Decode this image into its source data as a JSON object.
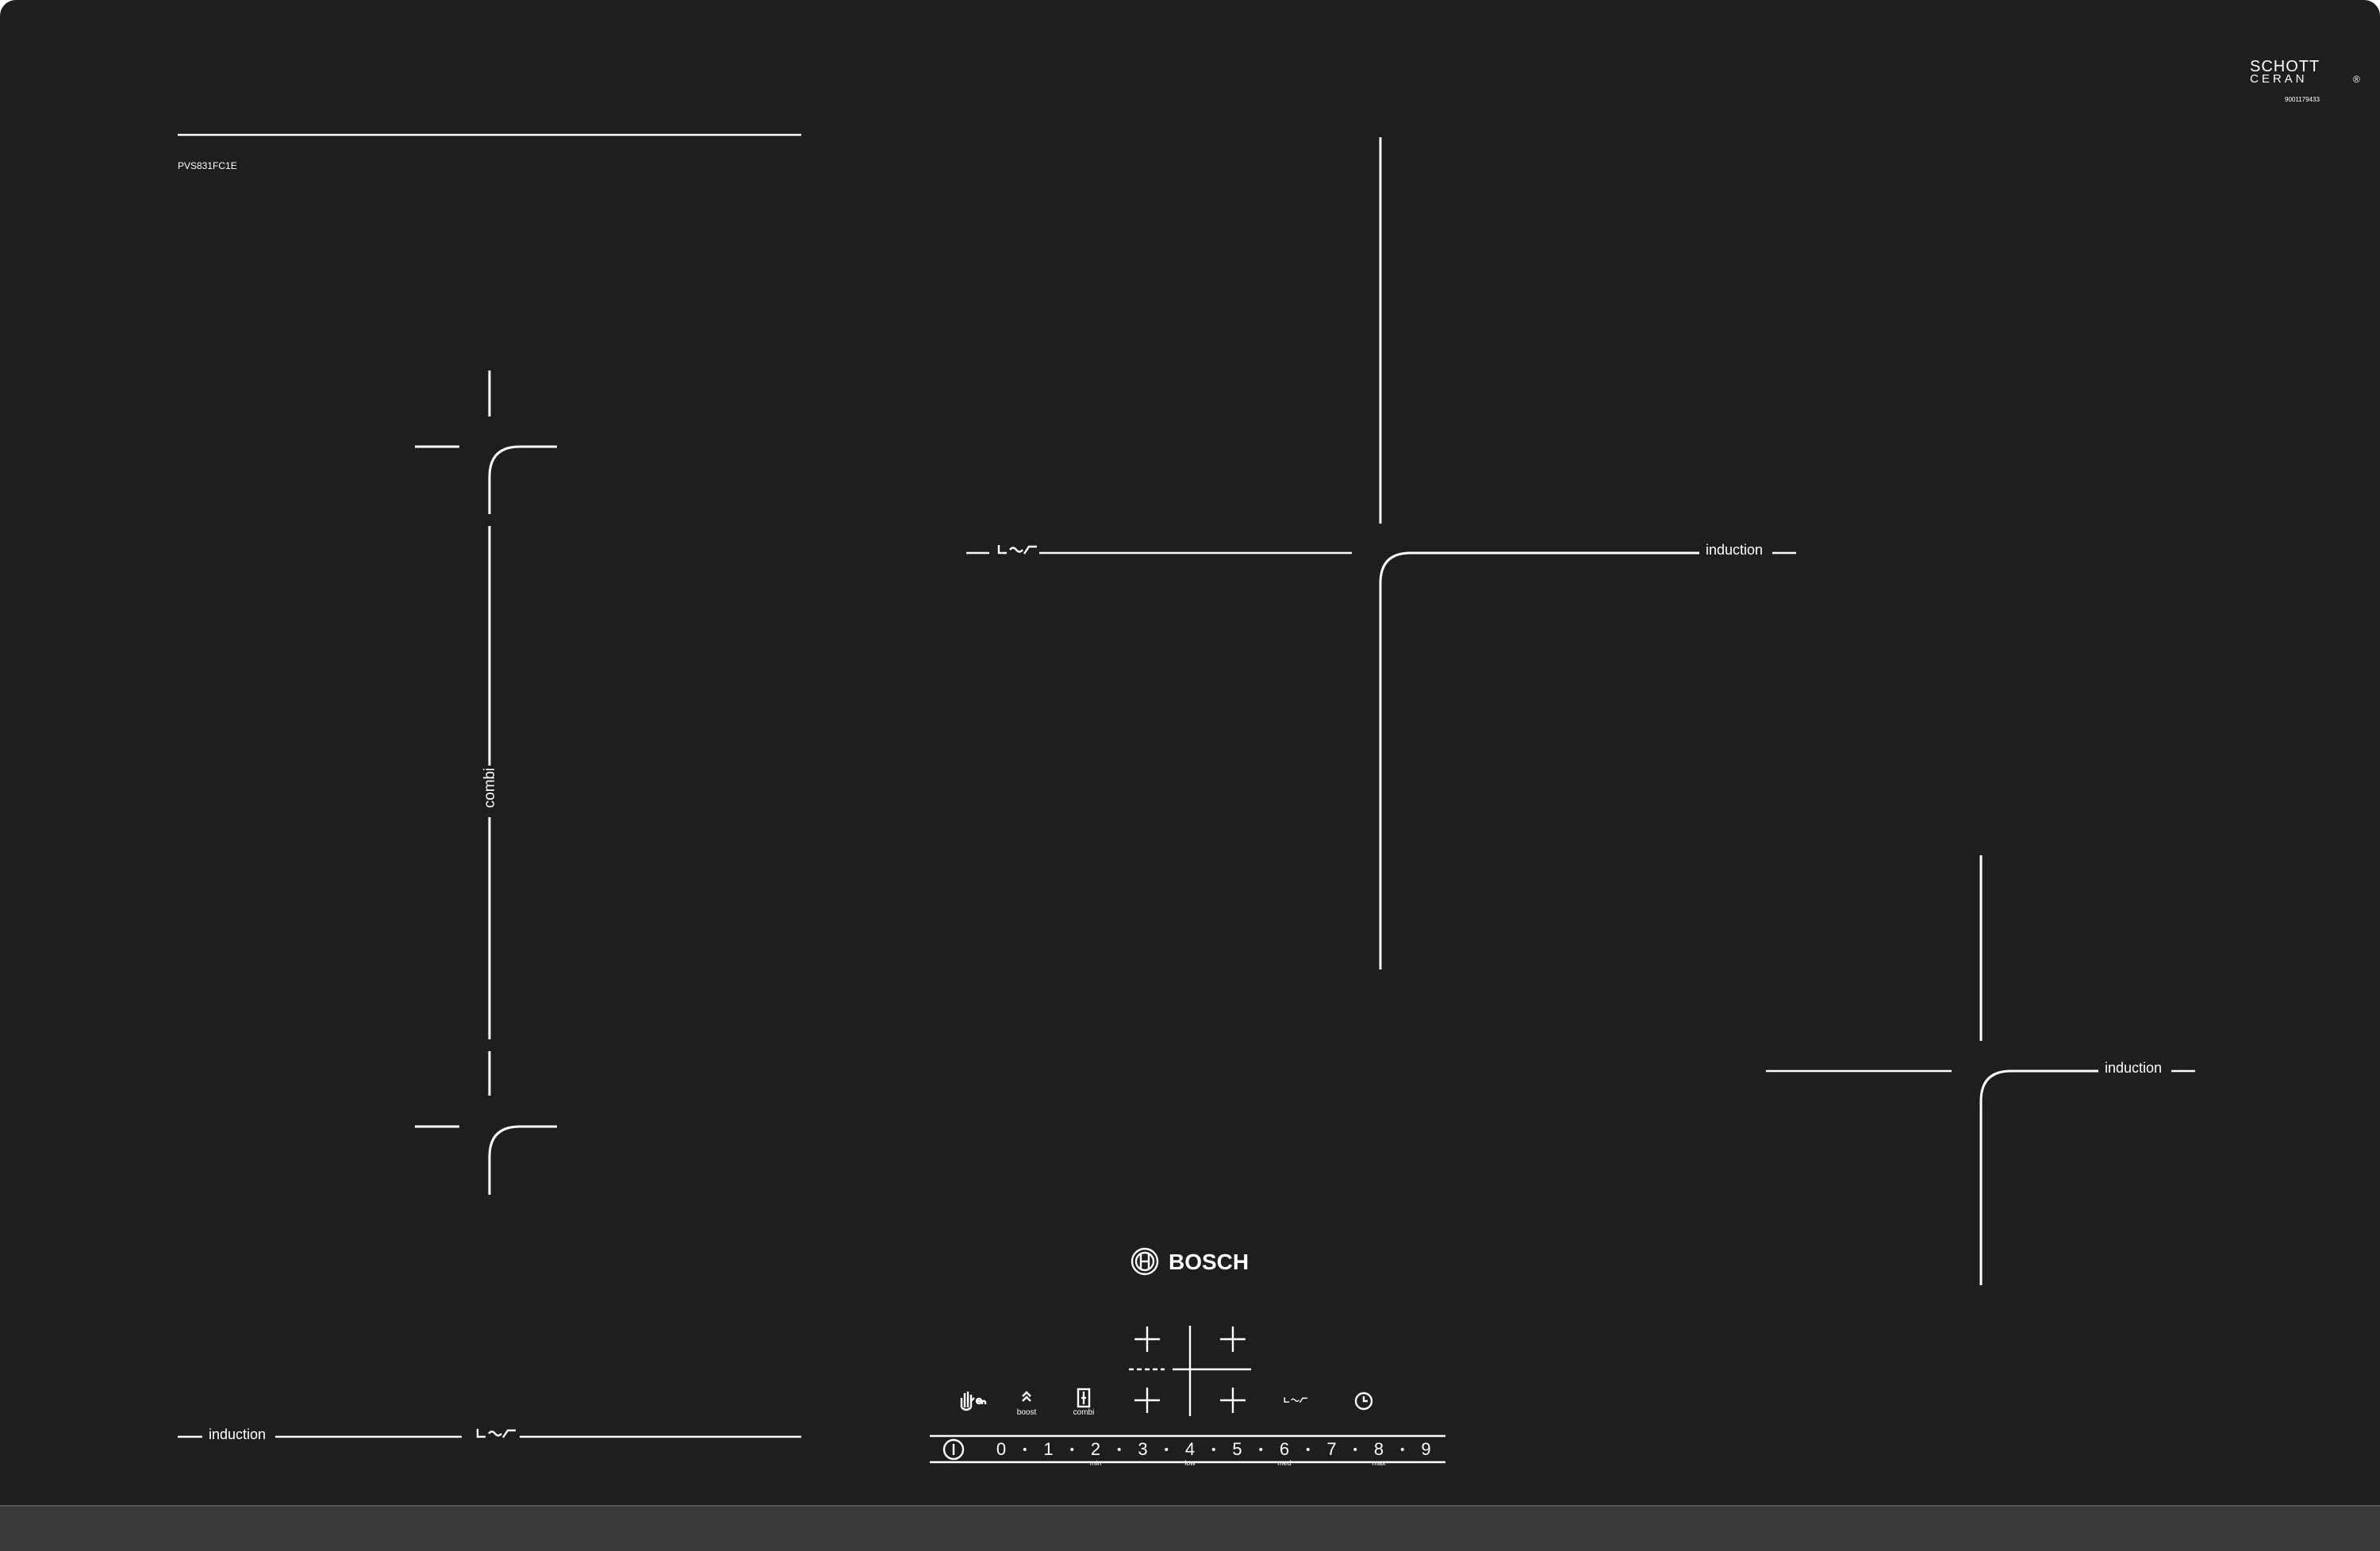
{
  "glass_brand": {
    "line1": "SCHOTT",
    "line2": "CERAN",
    "mark": "®",
    "code": "9001179433"
  },
  "model": "PVS831FC1E",
  "zones": {
    "left_flex": {
      "label": "combi",
      "bottom_label": "induction"
    },
    "top_right": {
      "label": "induction"
    },
    "bottom_right": {
      "label": "induction"
    }
  },
  "brand": {
    "name": "BOSCH",
    "logo_icon": "bosch-armature-logo"
  },
  "controls": {
    "functions": [
      {
        "id": "childlock",
        "icon": "hand-key-icon",
        "label": ""
      },
      {
        "id": "boost",
        "icon": "boost-chevron-icon",
        "label": "boost"
      },
      {
        "id": "combi",
        "icon": "combi-zone-icon",
        "label": "combi"
      },
      {
        "id": "move",
        "icon": "pan-move-icon",
        "label": ""
      },
      {
        "id": "timer",
        "icon": "clock-icon",
        "label": ""
      }
    ],
    "power_icon": "power-icon",
    "levels": [
      "0",
      "1",
      "2",
      "3",
      "4",
      "5",
      "6",
      "7",
      "8",
      "9"
    ],
    "level_marks": {
      "2": "min",
      "4": "low",
      "6": "med",
      "8": "max"
    }
  },
  "colors": {
    "glass": "#1f1e1d",
    "print": "#ffffff",
    "frame": "#3a3a3a"
  }
}
